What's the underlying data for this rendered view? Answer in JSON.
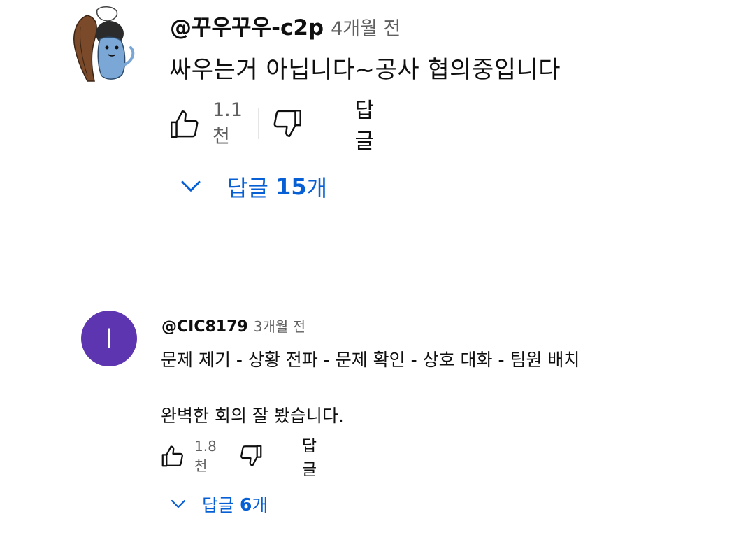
{
  "comments": [
    {
      "author": "@꾸우꾸우-c2p",
      "time": "4개월 전",
      "avatar_icon": "cartoon-character-avatar",
      "text_lines": [
        "싸우는거 아닙니다~공사 협의중입니다"
      ],
      "likes": "1.1천",
      "reply_label": "답글",
      "replies_label": "답글",
      "replies_count": "15",
      "replies_suffix": "개"
    },
    {
      "author": "@CIC8179",
      "time": "3개월 전",
      "avatar_letter": "I",
      "avatar_color": "#5e35b1",
      "text_lines": [
        "문제 제기 - 상황 전파 - 문제 확인 - 상호 대화 - 팀원 배치",
        "완벽한 회의 잘 봤습니다."
      ],
      "likes": "1.8천",
      "reply_label": "답글",
      "replies_label": "답글",
      "replies_count": "6",
      "replies_suffix": "개"
    }
  ],
  "colors": {
    "link_blue": "#065fd4",
    "secondary_text": "#606060",
    "primary_text": "#0f0f0f"
  }
}
